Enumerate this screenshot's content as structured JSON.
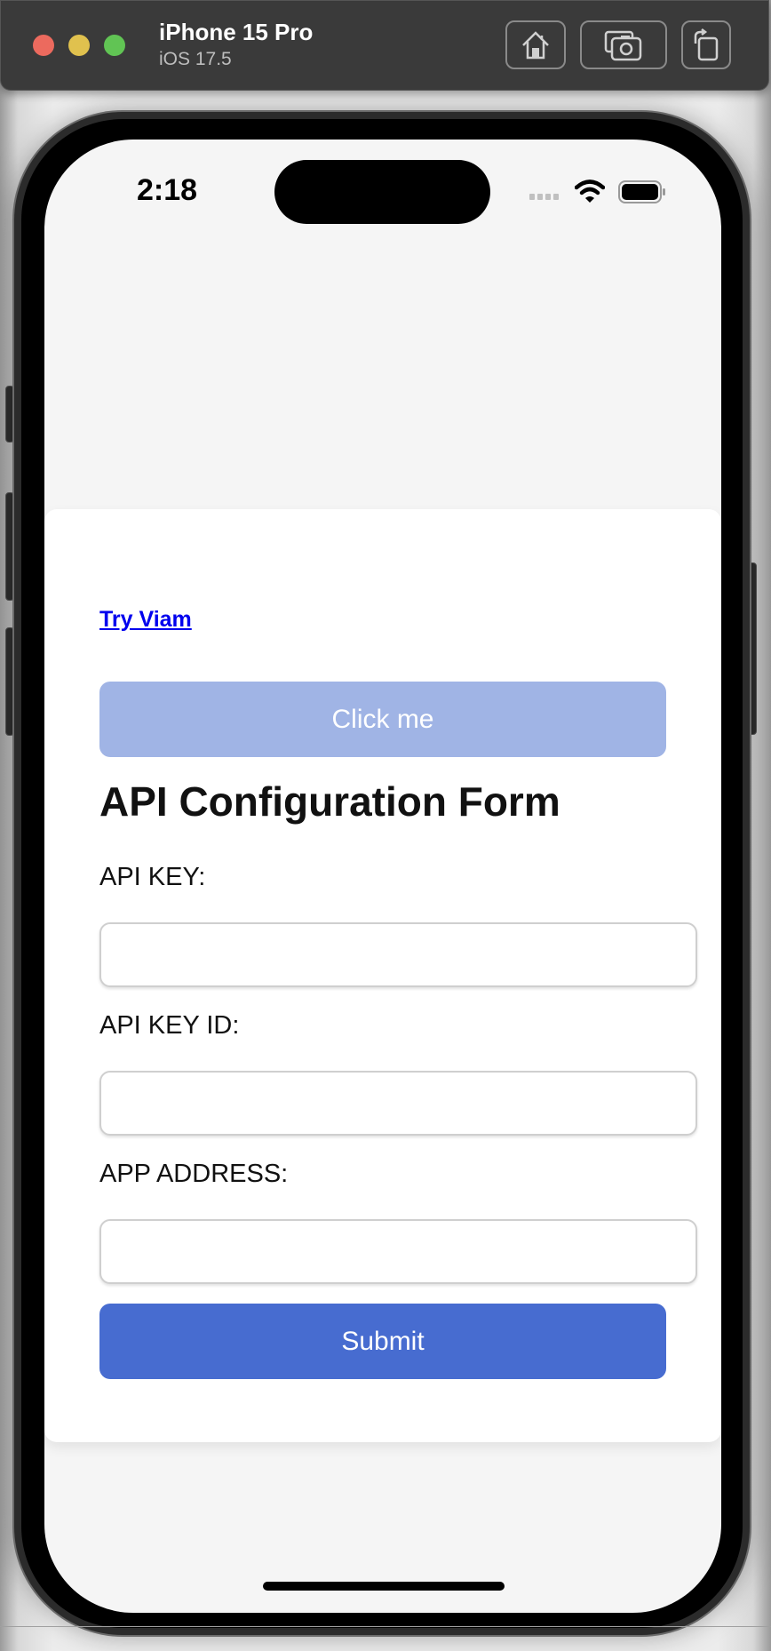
{
  "simulator": {
    "device_name": "iPhone 15 Pro",
    "os_version": "iOS 17.5",
    "buttons": [
      {
        "name": "home",
        "icon": "home-icon"
      },
      {
        "name": "screenshot",
        "icon": "camera-icon"
      },
      {
        "name": "rotate",
        "icon": "rotate-icon"
      }
    ]
  },
  "status_bar": {
    "time": "2:18",
    "icons": [
      "signal-icon",
      "wifi-icon",
      "battery-icon"
    ]
  },
  "page": {
    "link_text": "Try Viam",
    "click_button_label": "Click me",
    "form_title": "API Configuration Form",
    "fields": [
      {
        "label": "API KEY:",
        "value": "",
        "placeholder": ""
      },
      {
        "label": "API KEY ID:",
        "value": "",
        "placeholder": ""
      },
      {
        "label": "APP ADDRESS:",
        "value": "",
        "placeholder": ""
      }
    ],
    "submit_label": "Submit"
  },
  "colors": {
    "click_button": "#a0b4e5",
    "submit_button": "#476cd0",
    "link": "#0000ee"
  }
}
